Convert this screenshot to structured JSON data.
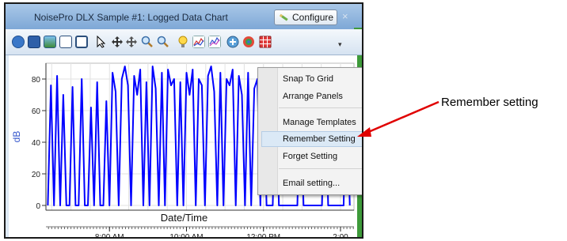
{
  "window": {
    "title": "NoisePro DLX Sample #1: Logged Data Chart",
    "configure_label": "Configure",
    "close_glyph": "×"
  },
  "toolbar": {
    "icons": [
      "help-icon",
      "save-icon",
      "image-icon",
      "new-page-icon",
      "window-icon",
      "select-cursor-icon",
      "pan-icon",
      "pan-all-icon",
      "zoom-in-icon",
      "zoom-out-icon",
      "lightbulb-icon",
      "line-chart-icon",
      "line-chart-alt-icon",
      "add-icon",
      "color-palette-icon",
      "grid-icon",
      "overflow-dropdown-icon"
    ],
    "overflow_glyph": "▾"
  },
  "chart_data": {
    "type": "line",
    "xlabel": "Date/Time",
    "ylabel": "dB",
    "ylim": [
      -3,
      90
    ],
    "yticks": [
      0,
      20,
      40,
      60,
      80
    ],
    "xtick_labels": [
      "8:00 AM",
      "10:00 AM",
      "12:00 PM",
      "2:00"
    ],
    "xtick_hours": [
      8,
      10,
      12,
      14
    ],
    "xlim_hours": [
      6.35,
      14.35
    ],
    "grid": true,
    "series": [
      {
        "color": "#0000ff",
        "x": [
          6.4,
          6.48,
          6.56,
          6.64,
          6.72,
          6.8,
          6.88,
          6.96,
          7.04,
          7.12,
          7.2,
          7.28,
          7.36,
          7.44,
          7.52,
          7.6,
          7.68,
          7.76,
          7.84,
          7.92,
          8.0,
          8.08,
          8.16,
          8.24,
          8.32,
          8.4,
          8.48,
          8.56,
          8.64,
          8.72,
          8.8,
          8.88,
          8.96,
          9.04,
          9.12,
          9.2,
          9.28,
          9.36,
          9.44,
          9.52,
          9.6,
          9.68,
          9.76,
          9.84,
          9.92,
          10.0,
          10.08,
          10.16,
          10.24,
          10.32,
          10.4,
          10.48,
          10.56,
          10.64,
          10.72,
          10.8,
          10.88,
          10.96,
          11.04,
          11.12,
          11.2,
          11.28,
          11.36,
          11.44,
          11.52,
          11.6,
          11.68,
          11.76,
          11.84,
          11.92,
          12.0,
          12.08,
          12.16,
          12.24,
          12.32,
          12.4,
          12.48,
          12.56,
          12.64,
          12.72,
          12.8,
          12.88,
          12.96,
          13.04,
          13.12,
          13.2,
          13.28,
          13.36,
          13.44,
          13.52,
          13.6,
          13.68,
          13.76,
          13.84,
          13.92,
          14.0,
          14.08,
          14.16,
          14.24
        ],
        "y": [
          0,
          76,
          0,
          82,
          0,
          70,
          0,
          0,
          75,
          0,
          0,
          80,
          0,
          0,
          62,
          0,
          78,
          0,
          0,
          66,
          0,
          84,
          72,
          0,
          80,
          88,
          76,
          0,
          82,
          70,
          86,
          0,
          78,
          0,
          88,
          74,
          0,
          84,
          0,
          86,
          76,
          80,
          0,
          78,
          0,
          84,
          70,
          86,
          0,
          80,
          76,
          0,
          82,
          88,
          72,
          0,
          84,
          0,
          80,
          76,
          86,
          0,
          82,
          70,
          0,
          84,
          0,
          74,
          80,
          0,
          86,
          0,
          0,
          0,
          82,
          0,
          0,
          0,
          0,
          0,
          0,
          0,
          76,
          0,
          0,
          0,
          0,
          0,
          0,
          0,
          80,
          0,
          0,
          0,
          0,
          0,
          0,
          84,
          0
        ]
      }
    ]
  },
  "context_menu": {
    "items": [
      {
        "label": "Snap To Grid"
      },
      {
        "label": "Arrange Panels"
      },
      {
        "label": "Manage Templates"
      },
      {
        "label": "Remember Setting"
      },
      {
        "label": "Forget Setting"
      },
      {
        "label": "Email setting..."
      }
    ],
    "highlighted_index": 3
  },
  "annotation": {
    "callout_text": "Remember setting",
    "arrow_color": "#e00000"
  }
}
